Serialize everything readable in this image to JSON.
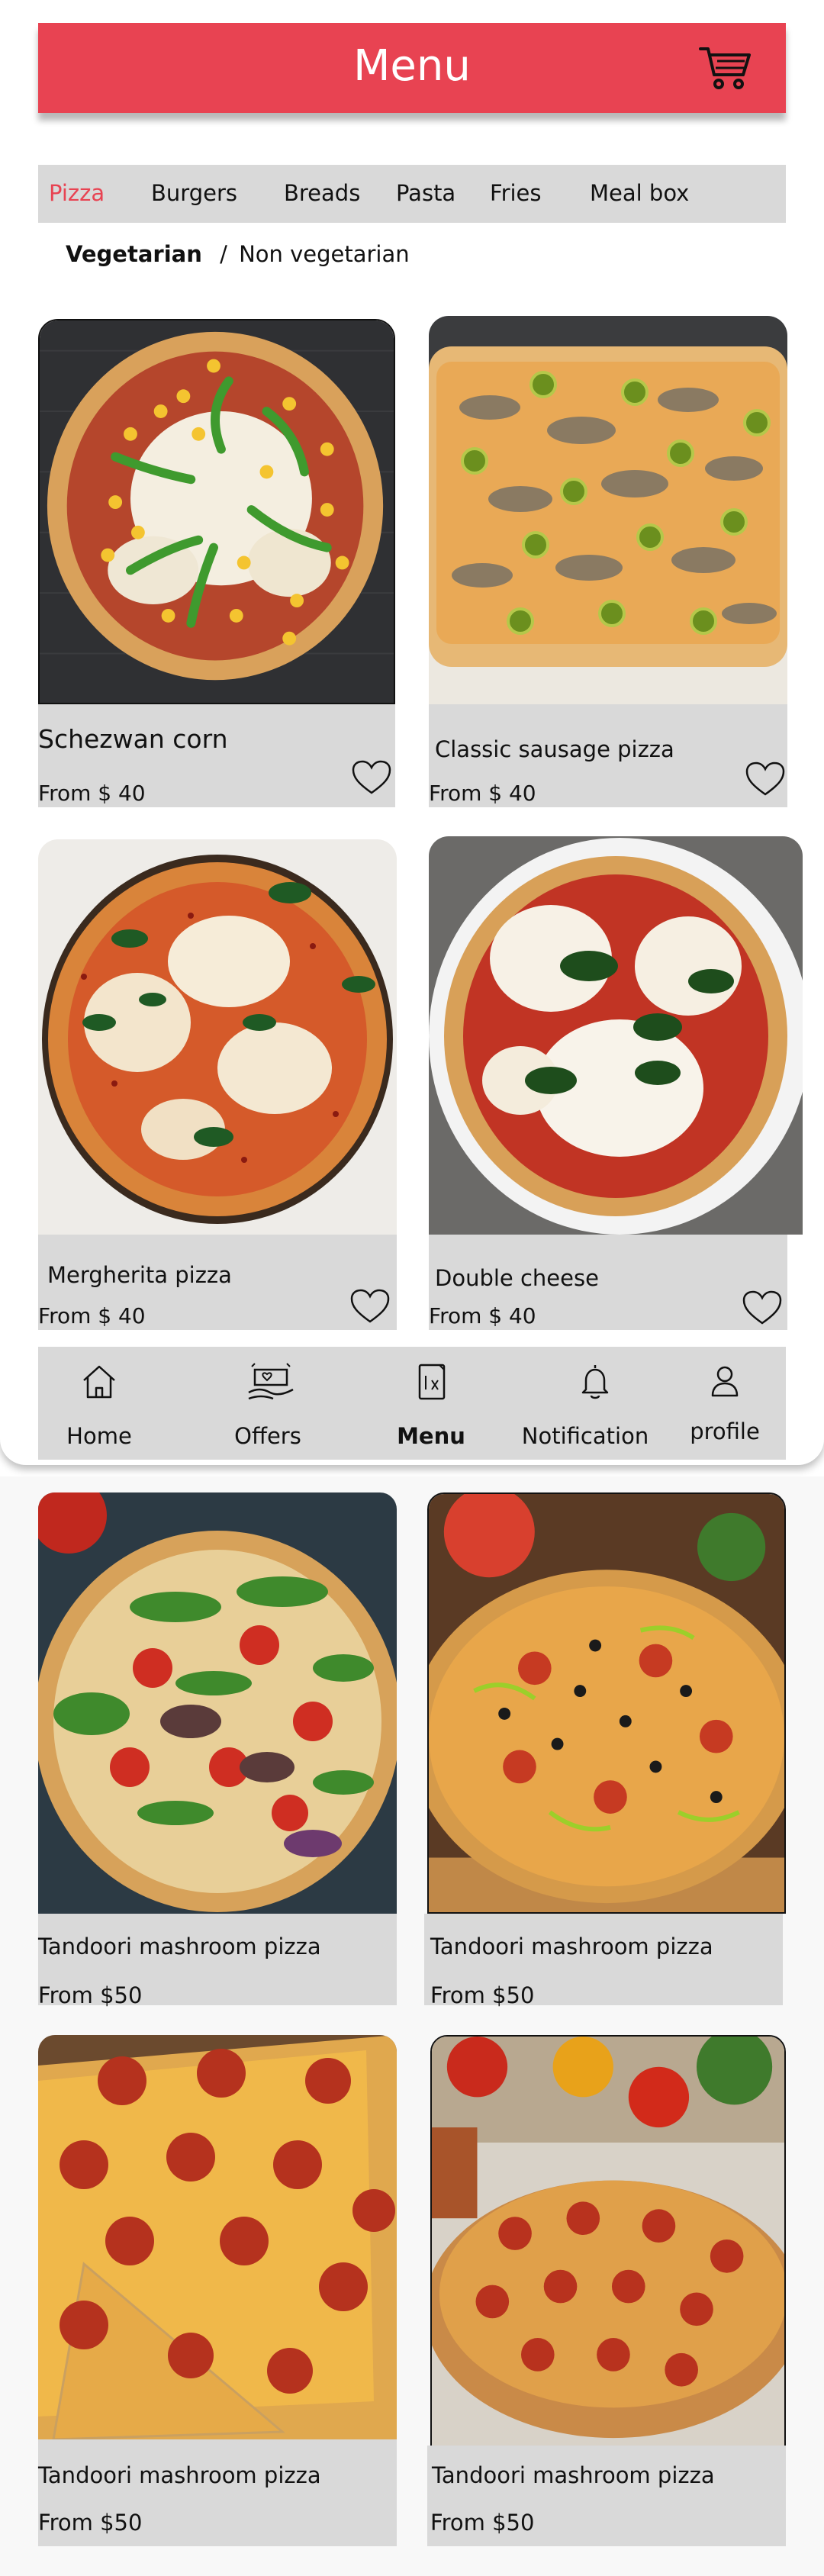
{
  "header": {
    "title": "Menu",
    "cart_icon": "cart-icon",
    "background": "#e84352"
  },
  "categories": [
    {
      "label": "Pizza",
      "active": true
    },
    {
      "label": "Burgers",
      "active": false
    },
    {
      "label": "Breads",
      "active": false
    },
    {
      "label": "Pasta",
      "active": false
    },
    {
      "label": "Fries",
      "active": false
    },
    {
      "label": "Meal box",
      "active": false
    }
  ],
  "filter": {
    "selected": "Vegetarian",
    "separator": "/",
    "other": "Non vegetarian"
  },
  "products": [
    {
      "name": "Schezwan corn",
      "price": "From $ 40",
      "heart_icon": "heart-icon"
    },
    {
      "name": "Classic sausage pizza",
      "price": "From $ 40",
      "heart_icon": "heart-icon"
    },
    {
      "name": "Mergherita pizza",
      "price": "From $ 40",
      "heart_icon": "heart-icon"
    },
    {
      "name": "Double cheese",
      "price": "From $ 40",
      "heart_icon": "heart-icon"
    }
  ],
  "nav": [
    {
      "label": "Home",
      "icon": "home-icon",
      "active": false
    },
    {
      "label": "Offers",
      "icon": "offers-icon",
      "active": false
    },
    {
      "label": "Menu",
      "icon": "menu-icon",
      "active": true
    },
    {
      "label": "Notification",
      "icon": "bell-icon",
      "active": false
    },
    {
      "label": "profile",
      "icon": "profile-icon",
      "active": false
    }
  ],
  "more_products": [
    {
      "name": "Tandoori mashroom pizza",
      "price": "From $50"
    },
    {
      "name": "Tandoori mashroom pizza",
      "price": "From $50"
    },
    {
      "name": "Tandoori mashroom pizza",
      "price": "From $50"
    },
    {
      "name": "Tandoori mashroom pizza",
      "price": "From $50"
    }
  ]
}
